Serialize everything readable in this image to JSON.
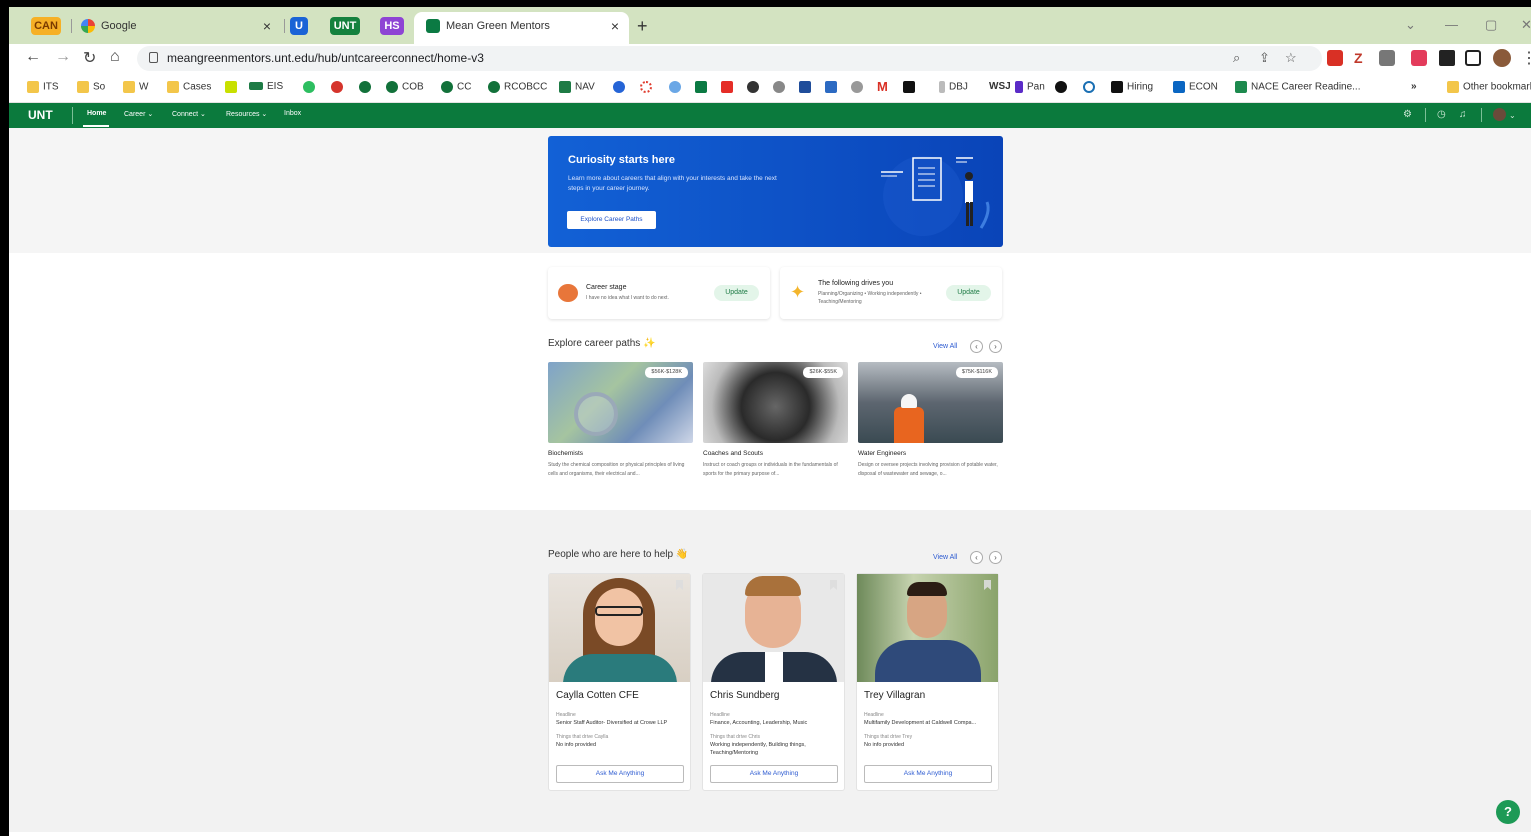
{
  "browser": {
    "tabs": [
      {
        "label": "CAN",
        "color": "#f6b026",
        "textcolor": "#7a3a00"
      },
      {
        "label": "Google"
      },
      {
        "label": "U",
        "color": "#1a63d6"
      },
      {
        "label": "UNT",
        "color": "#14813e"
      },
      {
        "label": "HS",
        "color": "#8e44d4"
      },
      {
        "label": "Mean Green Mentors"
      }
    ],
    "close_glyph": "×",
    "new_tab_glyph": "+",
    "url": "meangreenmentors.unt.edu/hub/untcareerconnect/home-v3",
    "bookmarks": [
      "ITS",
      "So",
      "W",
      "Cases",
      "EIS",
      "COB",
      "CC",
      "RCOBCC",
      "NAV",
      "DBJ",
      "WSJ",
      "Pan",
      "Hiring",
      "ECON",
      "NACE Career Readine...",
      "»",
      "Other bookmarks"
    ]
  },
  "appbar": {
    "logo": "UNT",
    "nav": [
      "Home",
      "Career ⌄",
      "Connect ⌄",
      "Resources ⌄",
      "Inbox"
    ]
  },
  "hero": {
    "title": "Curiosity starts here",
    "description": "Learn more about careers that align with your interests and take the next steps in your career journey.",
    "button": "Explore Career Paths"
  },
  "career_stage": {
    "title": "Career stage",
    "subtitle": "I have no idea what I want to do next.",
    "button": "Update"
  },
  "drives": {
    "title": "The following drives you",
    "subtitle": "Planning/Organizing • Working independently • Teaching/Mentoring",
    "button": "Update"
  },
  "paths_section": {
    "title": "Explore career paths ✨",
    "view_all": "View All",
    "cards": [
      {
        "salary": "$56K-$128K",
        "name": "Biochemists",
        "desc": "Study the chemical composition or physical principles of living cells and organisms, their electrical and..."
      },
      {
        "salary": "$26K-$55K",
        "name": "Coaches and Scouts",
        "desc": "Instruct or coach groups or individuals in the fundamentals of sports for the primary purpose of..."
      },
      {
        "salary": "$75K-$116K",
        "name": "Water Engineers",
        "desc": "Design or oversee projects involving provision of potable water, disposal of wastewater and sewage, o..."
      }
    ]
  },
  "people_section": {
    "title": "People who are here to help 👋",
    "view_all": "View All",
    "headline_label": "Headline",
    "ask_button": "Ask Me Anything",
    "people": [
      {
        "name": "Caylla Cotten CFE",
        "headline": "Senior Staff Auditor- Diversified at Crowe LLP",
        "drives_label": "Things that drive Caylla",
        "drives": "No info provided"
      },
      {
        "name": "Chris Sundberg",
        "headline": "Finance, Accounting, Leadership, Music",
        "drives_label": "Things that drive Chris",
        "drives": "Working independently, Building things, Teaching/Mentoring"
      },
      {
        "name": "Trey Villagran",
        "headline": "Multifamily Development at Caldwell Compa...",
        "drives_label": "Things that drive Trey",
        "drives": "No info provided"
      }
    ]
  },
  "help_button": "?"
}
